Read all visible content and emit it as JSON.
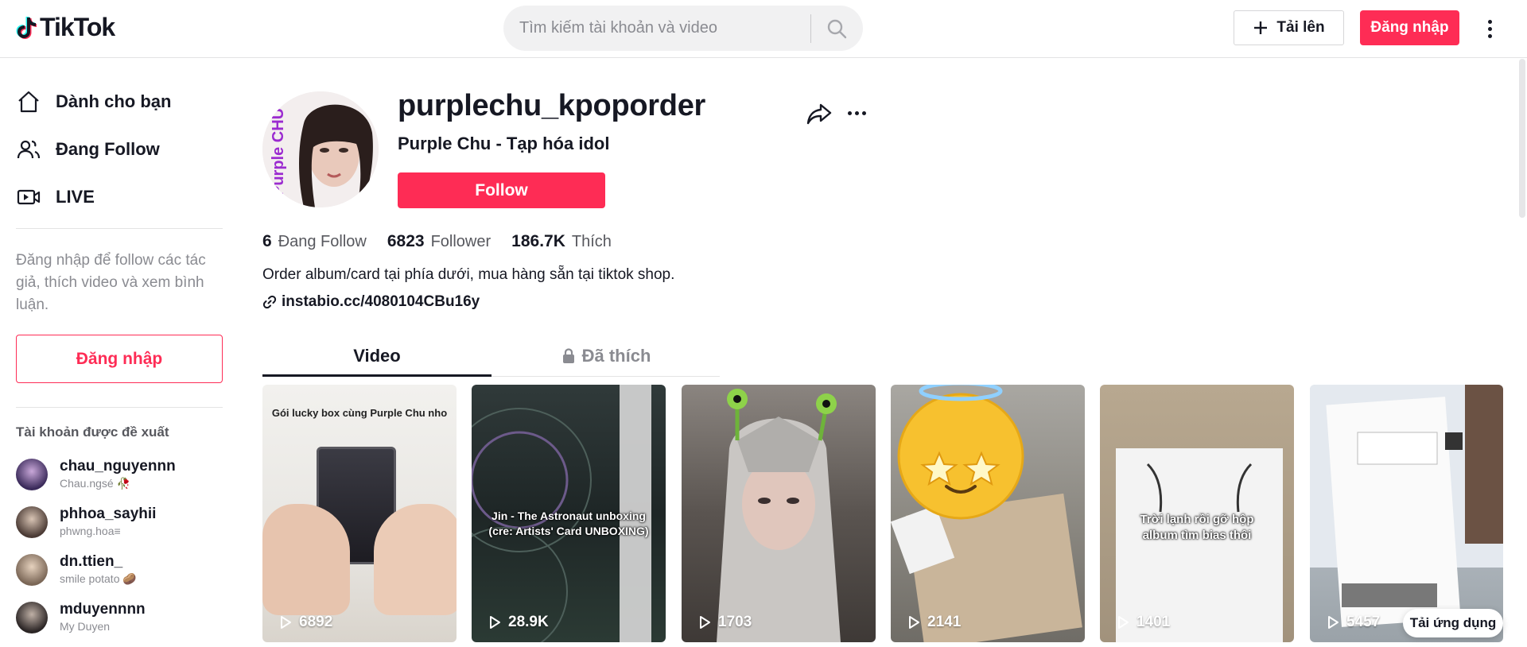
{
  "header": {
    "logo_text": "TikTok",
    "search_placeholder": "Tìm kiếm tài khoản và video",
    "upload_label": "Tải lên",
    "login_label": "Đăng nhập"
  },
  "sidebar": {
    "nav": [
      {
        "label": "Dành cho bạn",
        "icon": "home-icon"
      },
      {
        "label": "Đang Follow",
        "icon": "users-icon"
      },
      {
        "label": "LIVE",
        "icon": "live-icon"
      }
    ],
    "login_hint": "Đăng nhập để follow các tác giả, thích video và xem bình luận.",
    "login_button": "Đăng nhập",
    "suggested_title": "Tài khoản được đề xuất",
    "suggested": [
      {
        "name": "chau_nguyennn",
        "sub": "Chau.ngsé 🥀"
      },
      {
        "name": "phhoa_sayhii",
        "sub": "phwng.hoa≡"
      },
      {
        "name": "dn.ttien_",
        "sub": "smile potato 🥔"
      },
      {
        "name": "mduyennnn",
        "sub": "My Duyen"
      }
    ]
  },
  "profile": {
    "username": "purplechu_kpoporder",
    "nickname": "Purple Chu - Tạp hóa idol",
    "follow_label": "Follow",
    "avatar_text": "Purple CHU",
    "stats": {
      "following": "6",
      "following_label": "Đang Follow",
      "followers": "6823",
      "followers_label": "Follower",
      "likes": "186.7K",
      "likes_label": "Thích"
    },
    "bio": "Order album/card tại phía dưới, mua hàng sẵn tại tiktok shop.",
    "link": "instabio.cc/4080104CBu16y"
  },
  "tabs": {
    "video": "Video",
    "liked": "Đã thích"
  },
  "videos": [
    {
      "views": "6892",
      "caption": "Gói lucky box cùng Purple Chu nho"
    },
    {
      "views": "28.9K",
      "caption": "Jin - The Astronaut unboxing (cre: Artists' Card UNBOXING)"
    },
    {
      "views": "1703",
      "caption": ""
    },
    {
      "views": "2141",
      "caption": ""
    },
    {
      "views": "1401",
      "caption": "Trời lạnh rồi gỡ hộp album tìm bias thôi"
    },
    {
      "views": "5457",
      "caption": ""
    }
  ],
  "get_app": "Tải ứng dụng",
  "colors": {
    "accent": "#fe2c55",
    "text": "#161823",
    "muted": "#8a8b91"
  }
}
